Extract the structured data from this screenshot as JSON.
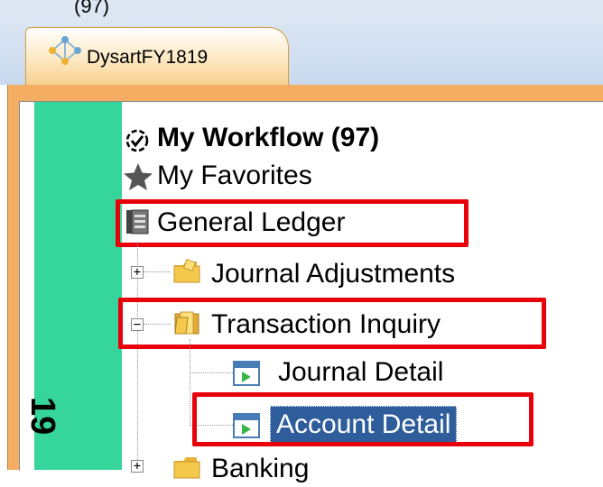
{
  "top_partial_text": "(97)",
  "tab": {
    "label": "DysartFY1819"
  },
  "side_vertical_text": "19",
  "tree": {
    "workflow": {
      "label": "My Workflow (97)",
      "icon": "workflow-check-icon"
    },
    "favorites": {
      "label": "My Favorites",
      "icon": "star-icon"
    },
    "general_ledger": {
      "label": "General Ledger",
      "icon": "ledger-icon"
    },
    "journal_adjustments": {
      "label": "Journal Adjustments",
      "icon": "folder-icon"
    },
    "transaction_inquiry": {
      "label": "Transaction Inquiry",
      "icon": "open-folder-icon"
    },
    "journal_detail": {
      "label": "Journal Detail",
      "icon": "form-icon"
    },
    "account_detail": {
      "label": "Account Detail",
      "icon": "form-icon",
      "selected": true
    },
    "banking": {
      "label": "Banking",
      "icon": "folder-icon"
    }
  },
  "colors": {
    "highlight_box": "#e8000b",
    "selection": "#2f5d9c",
    "side_panel": "#35d59b",
    "tab_frame": "#f4ad63"
  }
}
